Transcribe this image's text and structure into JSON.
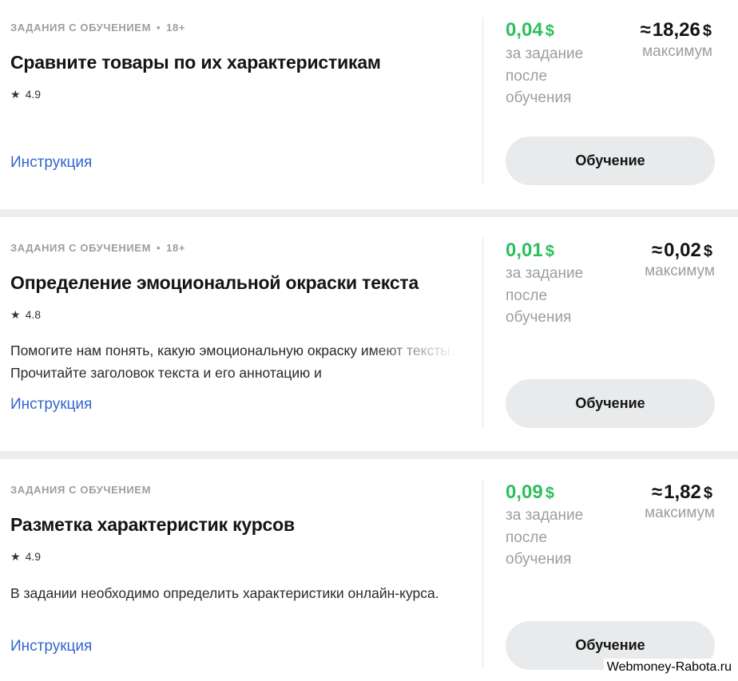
{
  "tasks": [
    {
      "category": "ЗАДАНИЯ С ОБУЧЕНИЕМ",
      "age": "18+",
      "title": "Сравните товары по их характеристикам",
      "rating": "4.9",
      "description": "",
      "instruction_label": "Инструкция",
      "price": "0,04",
      "price_currency": "$",
      "price_caption": "за задание после обучения",
      "max_approx": "≈",
      "max": "18,26",
      "max_currency": "$",
      "max_caption": "максимум",
      "button_label": "Обучение"
    },
    {
      "category": "ЗАДАНИЯ С ОБУЧЕНИЕМ",
      "age": "18+",
      "title": "Определение эмоциональной окраски текста",
      "rating": "4.8",
      "description": "Помогите нам понять, какую эмоциональную окраску имеют тексты. Прочитайте заголовок текста и его аннотацию и",
      "instruction_label": "Инструкция",
      "price": "0,01",
      "price_currency": "$",
      "price_caption": "за задание после обучения",
      "max_approx": "≈",
      "max": "0,02",
      "max_currency": "$",
      "max_caption": "максимум",
      "button_label": "Обучение"
    },
    {
      "category": "ЗАДАНИЯ С ОБУЧЕНИЕМ",
      "age": "",
      "title": "Разметка характеристик курсов",
      "rating": "4.9",
      "description": "В задании необходимо определить характеристики онлайн-курса.",
      "instruction_label": "Инструкция",
      "price": "0,09",
      "price_currency": "$",
      "price_caption": "за задание после обучения",
      "max_approx": "≈",
      "max": "1,82",
      "max_currency": "$",
      "max_caption": "максимум",
      "button_label": "Обучение"
    }
  ],
  "rating_icon": "star-icon",
  "watermark": "Webmoney-Rabota.ru",
  "colors": {
    "price": "#2bbf5e",
    "link": "#3366cc",
    "muted": "#9a9ea3",
    "button_bg": "#e8eaec",
    "separator": "#ecedef"
  }
}
